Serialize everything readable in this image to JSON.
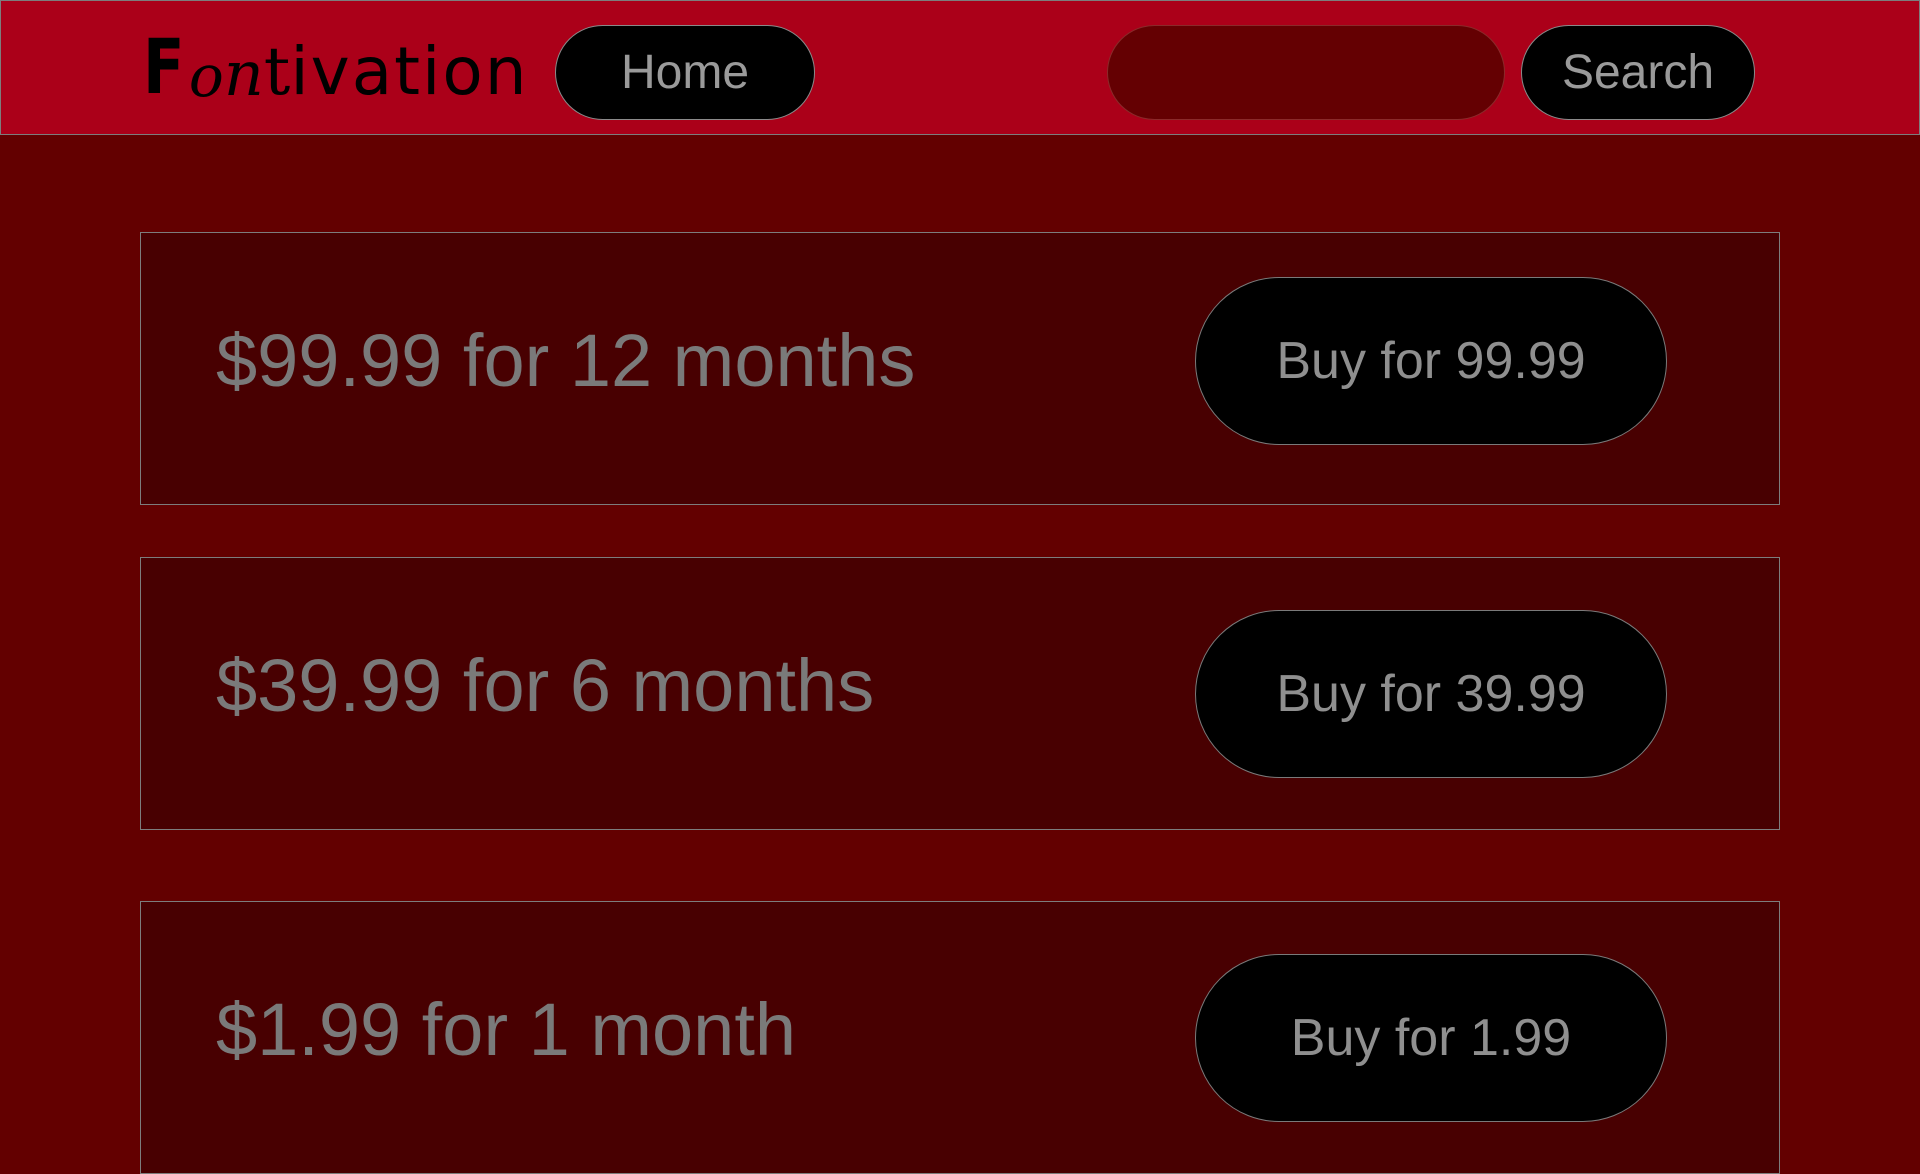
{
  "app": {
    "logo_parts": [
      "F",
      "o",
      "n",
      "t",
      "ivation"
    ]
  },
  "nav": {
    "home_label": "Home",
    "search_label": "Search",
    "search_value": ""
  },
  "plans": [
    {
      "label": "$99.99 for 12 months",
      "button": "Buy for 99.99"
    },
    {
      "label": "$39.99 for 6 months",
      "button": "Buy for 39.99"
    },
    {
      "label": "$1.99 for 1 month",
      "button": "Buy for 1.99"
    }
  ],
  "colors": {
    "navbar": "#ab0019",
    "page_background": "#630000",
    "card_background": "#480001",
    "button_background": "#000000",
    "muted_text": "#7a7a7a"
  }
}
